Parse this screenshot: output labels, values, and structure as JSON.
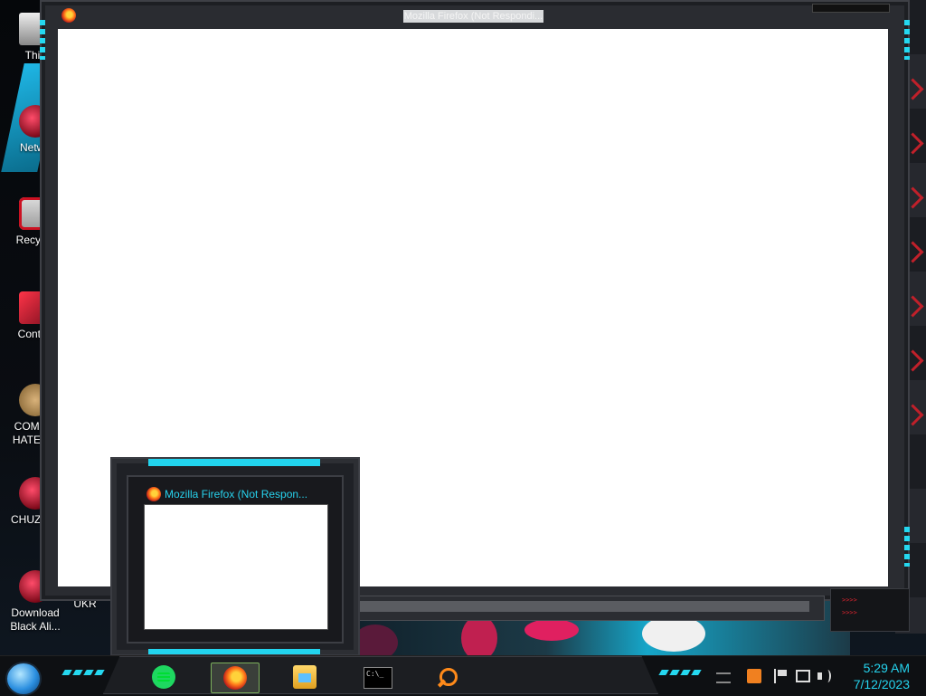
{
  "desktop_icons": [
    {
      "label": "This",
      "icon": "this-pc-icon"
    },
    {
      "label": "Netwo",
      "icon": "network-icon"
    },
    {
      "label": "Recycle",
      "icon": "recycle-bin-icon"
    },
    {
      "label": "Control",
      "icon": "control-panel-icon"
    },
    {
      "label": "COMMU HATE TH",
      "icon": "money-bag-icon"
    },
    {
      "label": "CHUZ CU",
      "icon": "red-creature-icon"
    },
    {
      "label": "Download Black Ali...",
      "icon": "download-icon"
    },
    {
      "label": "UKR",
      "icon": "ukr-icon"
    }
  ],
  "main_window": {
    "title": "Mozilla Firefox (Not Respondi..."
  },
  "taskbar_preview": {
    "title": "Mozilla Firefox (Not Respon..."
  },
  "taskbar": {
    "apps": [
      {
        "name": "Spotify",
        "icon": "spotify-icon",
        "active": false
      },
      {
        "name": "Firefox",
        "icon": "firefox-icon",
        "active": true
      },
      {
        "name": "File Explorer",
        "icon": "file-explorer-icon",
        "active": false
      },
      {
        "name": "Command Prompt",
        "icon": "command-prompt-icon",
        "active": false,
        "glyph": "C:\\_"
      },
      {
        "name": "Search",
        "icon": "search-icon",
        "active": false
      }
    ]
  },
  "tray": {
    "icons": [
      "upload-icon",
      "flag-icon",
      "network-icon",
      "volume-icon"
    ],
    "time": "5:29 AM",
    "date": "7/12/2023"
  },
  "colors": {
    "accent": "#25d3ee",
    "alert": "#e2242f",
    "frame": "#2a2c31"
  }
}
